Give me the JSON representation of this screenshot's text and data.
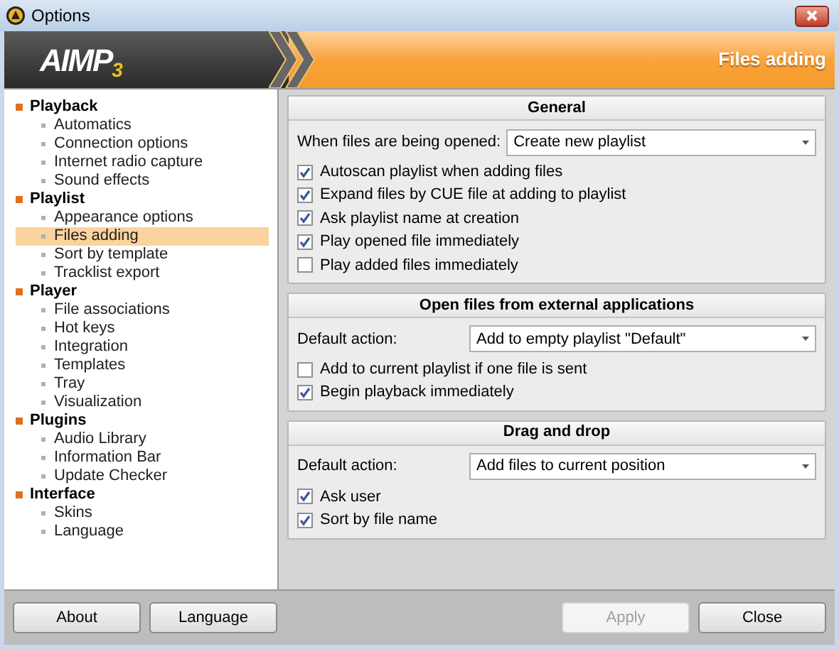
{
  "window": {
    "title": "Options"
  },
  "banner": {
    "logo": "AIMP",
    "logo_version": "3",
    "title": "Files adding"
  },
  "sidebar": {
    "items": [
      {
        "label": "Playback",
        "children": [
          {
            "label": "Automatics",
            "selected": false
          },
          {
            "label": "Connection options",
            "selected": false
          },
          {
            "label": "Internet radio capture",
            "selected": false
          },
          {
            "label": "Sound effects",
            "selected": false
          }
        ]
      },
      {
        "label": "Playlist",
        "children": [
          {
            "label": "Appearance options",
            "selected": false
          },
          {
            "label": "Files adding",
            "selected": true
          },
          {
            "label": "Sort by template",
            "selected": false
          },
          {
            "label": "Tracklist export",
            "selected": false
          }
        ]
      },
      {
        "label": "Player",
        "children": [
          {
            "label": "File associations",
            "selected": false
          },
          {
            "label": "Hot keys",
            "selected": false
          },
          {
            "label": "Integration",
            "selected": false
          },
          {
            "label": "Templates",
            "selected": false
          },
          {
            "label": "Tray",
            "selected": false
          },
          {
            "label": "Visualization",
            "selected": false
          }
        ]
      },
      {
        "label": "Plugins",
        "children": [
          {
            "label": "Audio Library",
            "selected": false
          },
          {
            "label": "Information Bar",
            "selected": false
          },
          {
            "label": "Update Checker",
            "selected": false
          }
        ]
      },
      {
        "label": "Interface",
        "children": [
          {
            "label": "Skins",
            "selected": false
          },
          {
            "label": "Language",
            "selected": false
          }
        ]
      }
    ]
  },
  "sections": [
    {
      "title": "General",
      "rows": [
        {
          "kind": "select",
          "label": "When files are being opened:",
          "value": "Create new playlist"
        },
        {
          "kind": "checkbox",
          "label": "Autoscan playlist when adding files",
          "checked": true
        },
        {
          "kind": "checkbox",
          "label": "Expand files by CUE file at adding to playlist",
          "checked": true
        },
        {
          "kind": "checkbox",
          "label": "Ask playlist name at creation",
          "checked": true
        },
        {
          "kind": "checkbox",
          "label": "Play opened file immediately",
          "checked": true
        },
        {
          "kind": "checkbox",
          "label": "Play added files immediately",
          "checked": false
        }
      ]
    },
    {
      "title": "Open files from external applications",
      "rows": [
        {
          "kind": "select",
          "label": "Default action:",
          "value": "Add to empty playlist \"Default\""
        },
        {
          "kind": "checkbox",
          "label": "Add to current playlist if one file is sent",
          "checked": false
        },
        {
          "kind": "checkbox",
          "label": "Begin playback immediately",
          "checked": true
        }
      ]
    },
    {
      "title": "Drag and drop",
      "rows": [
        {
          "kind": "select",
          "label": "Default action:",
          "value": "Add files to current position"
        },
        {
          "kind": "checkbox",
          "label": "Ask user",
          "checked": true
        },
        {
          "kind": "checkbox",
          "label": "Sort by file name",
          "checked": true
        }
      ]
    }
  ],
  "left_buttons": [
    {
      "label": "About",
      "disabled": false
    },
    {
      "label": "Language",
      "disabled": false
    }
  ],
  "right_buttons": [
    {
      "label": "Apply",
      "disabled": true
    },
    {
      "label": "Close",
      "disabled": false
    }
  ]
}
